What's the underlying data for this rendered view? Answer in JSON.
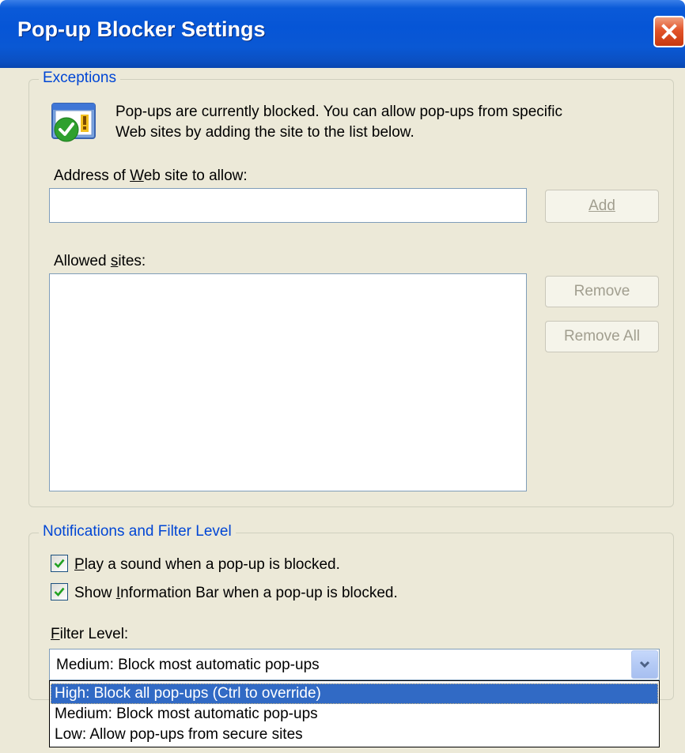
{
  "window": {
    "title": "Pop-up Blocker Settings"
  },
  "exceptions": {
    "group_label": "Exceptions",
    "info_line1": "Pop-ups are currently blocked.  You can allow pop-ups from specific",
    "info_line2": "Web sites by adding the site to the list below.",
    "address_label_pre": "Address of ",
    "address_label_key": "W",
    "address_label_post": "eb site to allow:",
    "address_value": "",
    "add_button": "Add",
    "allowed_label_pre": "Allowed ",
    "allowed_label_key": "s",
    "allowed_label_post": "ites:",
    "remove_button": "Remove",
    "remove_all_button": "Remove All"
  },
  "notifications": {
    "group_label": "Notifications and Filter Level",
    "play_sound": {
      "checked": true,
      "key": "P",
      "rest": "lay a sound when a pop-up is blocked."
    },
    "show_info_bar": {
      "checked": true,
      "pre": "Show ",
      "key": "I",
      "rest": "nformation Bar when a pop-up is blocked."
    },
    "filter_label_key": "F",
    "filter_label_rest": "ilter Level:",
    "filter_selected": "Medium: Block most automatic pop-ups",
    "filter_options": [
      "High: Block all pop-ups (Ctrl to override)",
      "Medium: Block most automatic pop-ups",
      "Low: Allow pop-ups from secure sites"
    ],
    "highlighted_option_index": 0
  },
  "icons": {
    "close": "close-icon",
    "popup_shield": "popup-blocker-icon",
    "check": "checkmark-icon",
    "dropdown": "chevron-down-icon"
  },
  "colors": {
    "titlebar": "#0655d6",
    "dialog_bg": "#ece9d8",
    "group_label": "#0046d5",
    "selection": "#316ac5"
  }
}
